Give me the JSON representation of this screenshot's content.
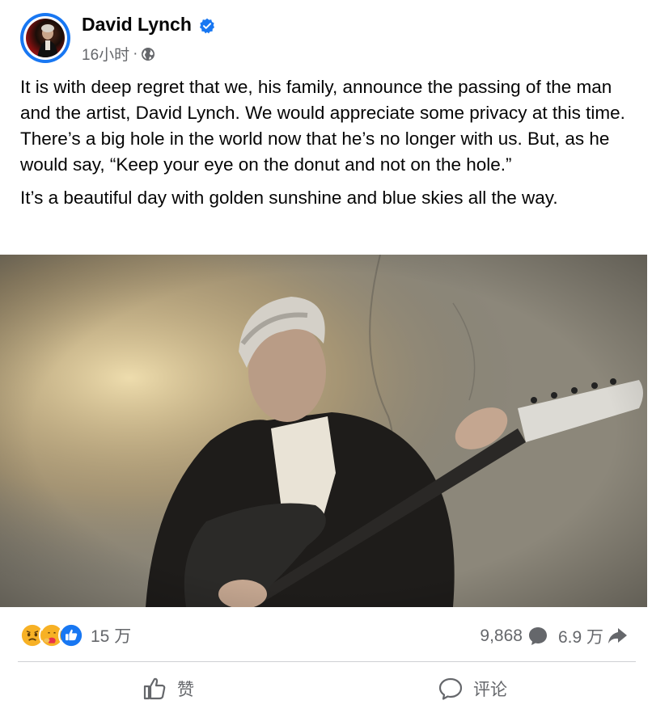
{
  "post": {
    "author": "David Lynch",
    "time": "16小时",
    "separator": "·",
    "paragraphs": [
      "It is with deep regret that we, his family, announce the passing of the man and the artist, David Lynch.  We would appreciate some privacy at this time.  There’s a big hole in the world now that he’s no longer with us.  But, as he would say, “Keep your eye on the donut and not on the hole.”",
      "It’s a beautiful day with golden sunshine and blue skies all the way."
    ],
    "reactions": [
      "sad-reaction",
      "care-reaction",
      "like-reaction"
    ],
    "reaction_count": "15 万",
    "comment_count": "9,868",
    "share_count": "6.9 万"
  },
  "actions": {
    "like_label": "赞",
    "comment_label": "评论"
  },
  "colors": {
    "verified": "#1877f2",
    "secondary_text": "#65676b",
    "like_blue": "#1877f2",
    "sad_yellow": "#f7b125"
  }
}
